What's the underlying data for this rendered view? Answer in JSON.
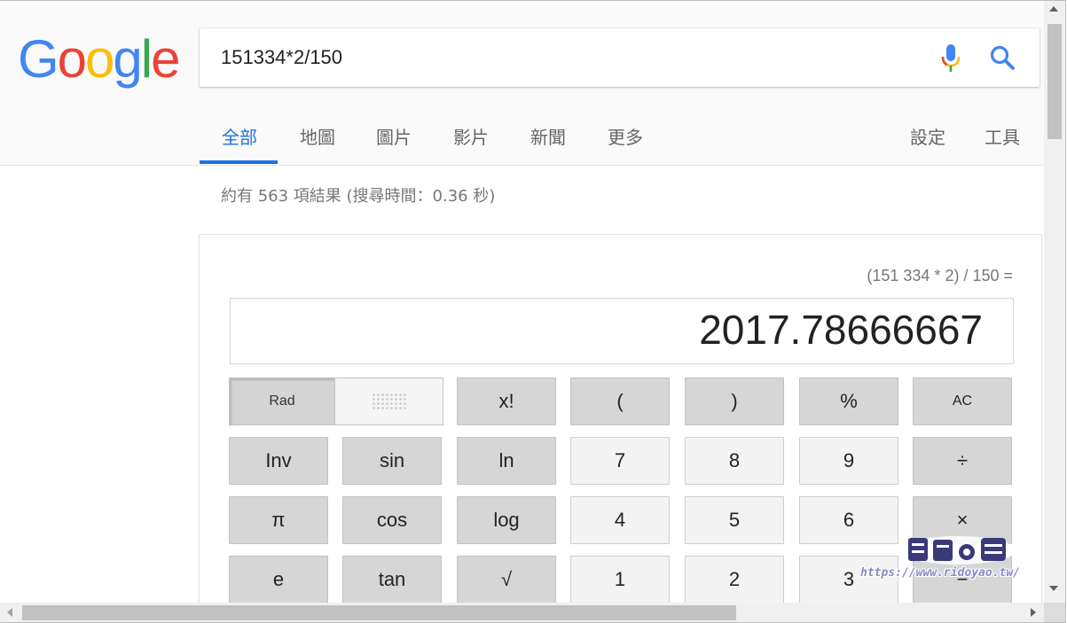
{
  "logo": {
    "letters": [
      "G",
      "o",
      "o",
      "g",
      "l",
      "e"
    ],
    "colors": [
      "#4285F4",
      "#EA4335",
      "#FBBC05",
      "#4285F4",
      "#34A853",
      "#EA4335"
    ]
  },
  "search": {
    "value": "151334*2/150",
    "mic_icon": "microphone-icon",
    "search_icon": "magnifier-icon",
    "accent": "#4285F4"
  },
  "tabs": {
    "items": [
      "全部",
      "地圖",
      "圖片",
      "影片",
      "新聞",
      "更多"
    ],
    "active": "全部",
    "right": [
      "設定",
      "工具"
    ],
    "active_color": "#1a73e8"
  },
  "result_stats": "約有 563 項結果 (搜尋時間：0.36 秒)",
  "calculator": {
    "history": "(151 334 * 2) / 150 =",
    "result": "2017.78666667",
    "mode": {
      "rad": "Rad",
      "deg": ""
    },
    "rows": [
      [
        "x!",
        "(",
        ")",
        "%",
        "AC"
      ],
      [
        "Inv",
        "sin",
        "ln",
        "7",
        "8",
        "9",
        "÷"
      ],
      [
        "π",
        "cos",
        "log",
        "4",
        "5",
        "6",
        "×"
      ],
      [
        "e",
        "tan",
        "√",
        "1",
        "2",
        "3",
        "−"
      ]
    ]
  },
  "watermark": {
    "url": "https://www.ridoyao.tw/"
  }
}
